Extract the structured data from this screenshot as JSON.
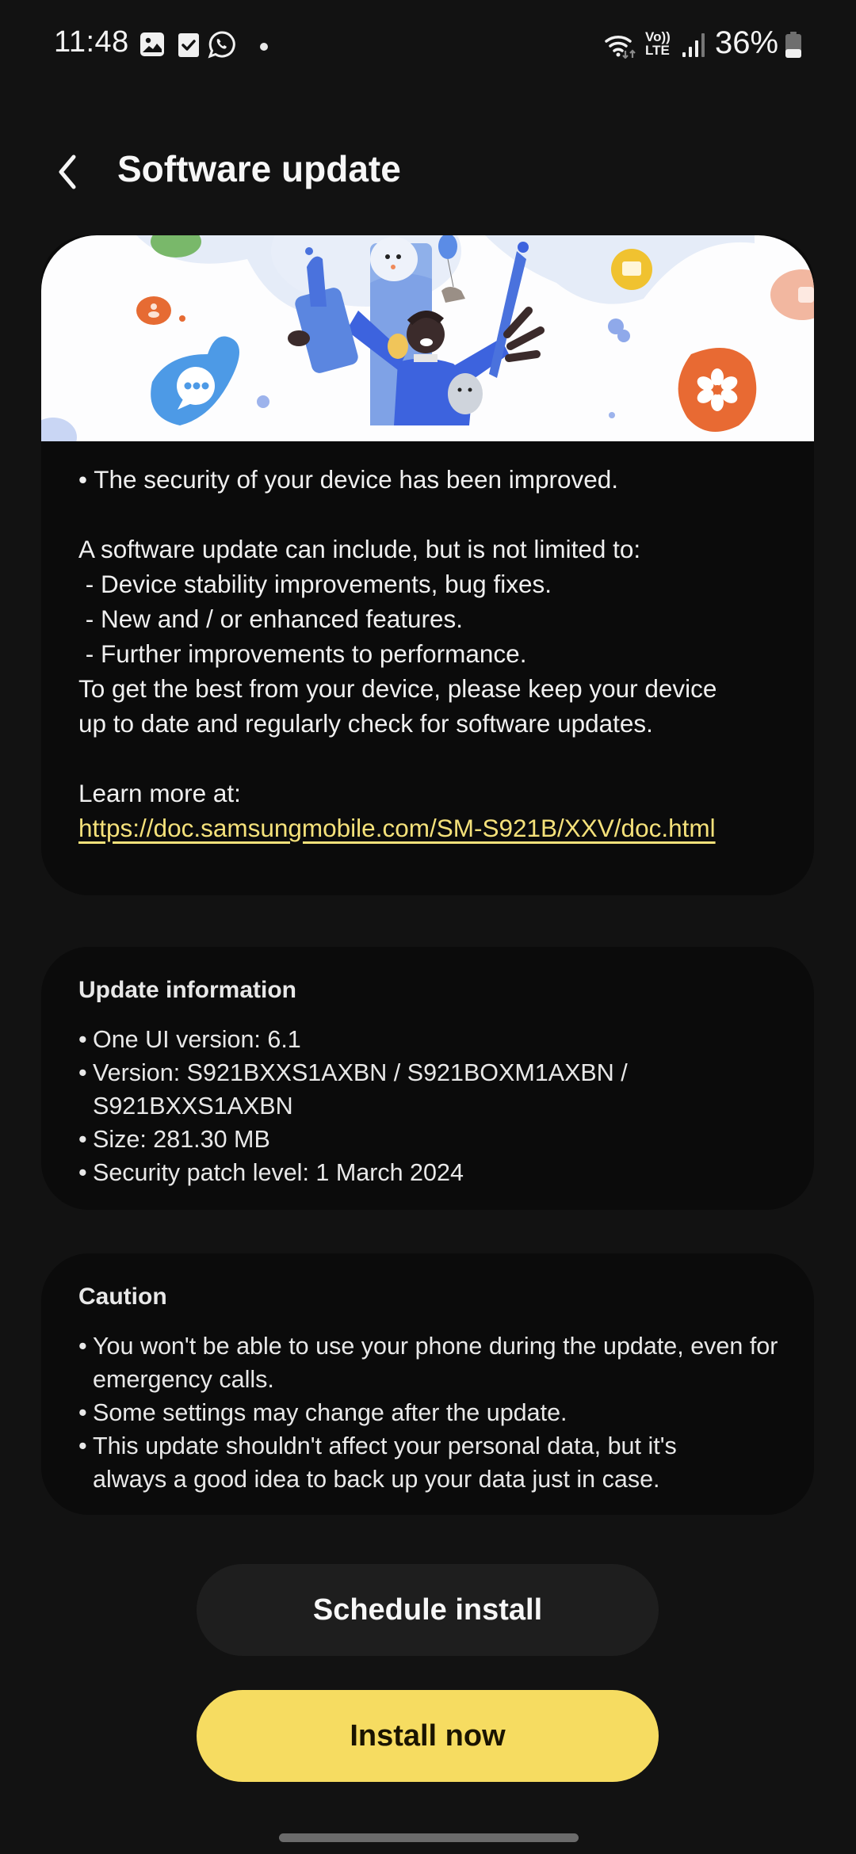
{
  "status_bar": {
    "time": "11:48",
    "notification_icons": [
      "gallery-icon",
      "checkbox-icon",
      "whatsapp-icon",
      "dot-icon"
    ],
    "system_icons": [
      "wifi-icon",
      "volte-icon",
      "signal-icon",
      "battery-icon"
    ],
    "volte_top": "Vo))",
    "volte_bottom": "LTE",
    "battery_percent": "36%",
    "battery_level": 0.36
  },
  "header": {
    "back_icon": "chevron-left-icon",
    "title": "Software update"
  },
  "release_notes": {
    "lines": [
      "• The security of your device has been improved.",
      "",
      "A software update can include, but is not limited to:",
      " - Device stability improvements, bug fixes.",
      " - New and / or enhanced features.",
      " - Further improvements to performance.",
      "To get the best from your device, please keep your device",
      "up to date and regularly check for software updates.",
      "",
      "Learn more at:"
    ],
    "link": "https://doc.samsungmobile.com/SM-S921B/XXV/doc.html"
  },
  "update_info": {
    "heading": "Update information",
    "items": [
      "One UI version: 6.1",
      "Version: S921BXXS1AXBN / S921BOXM1AXBN / S921BXXS1AXBN",
      "Size: 281.30 MB",
      "Security patch level: 1 March 2024"
    ]
  },
  "caution": {
    "heading": "Caution",
    "items": [
      "You won't be able to use your phone during the update, even for emergency calls.",
      "Some settings may change after the update.",
      "This update shouldn't affect your personal data, but it's always a good idea to back up your data just in case."
    ]
  },
  "buttons": {
    "schedule": "Schedule install",
    "install": "Install now"
  },
  "colors": {
    "background": "#121212",
    "card": "#0b0b0b",
    "accent_yellow": "#f6dc61",
    "link": "#f5e17a"
  }
}
